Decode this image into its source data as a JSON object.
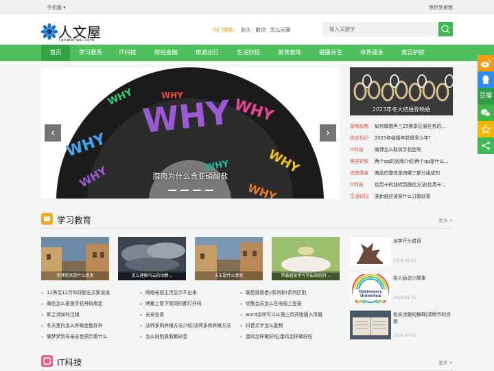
{
  "topbar": {
    "mobile": "手机版 ▾",
    "save": "保存到桌面"
  },
  "logo": {
    "name": "人文屋",
    "domain": "renwenwu.com"
  },
  "hot": {
    "label": "热门搜索:",
    "keywords": [
      "兆头",
      "歌词",
      "怎么回事"
    ]
  },
  "search": {
    "placeholder": "输入关键字"
  },
  "nav": [
    "首页",
    "学习教育",
    "IT科技",
    "财经金融",
    "旅游出行",
    "生活妙招",
    "美食美味",
    "健康养生",
    "体育健身",
    "美容护肤"
  ],
  "banner": {
    "caption": "腊肉为什么含亚硝酸盐",
    "word": "WHY"
  },
  "side": {
    "caption": "2023年冬大结婚算晚婚",
    "news": [
      {
        "cat": "游戏攻略",
        "title": "如何做暗黑三25赛季征服任务的..."
      },
      {
        "cat": "综合知识",
        "title": "2023年结婚年龄是多少年?"
      },
      {
        "cat": "IT科技",
        "title": "微博怎么取消手机型号"
      },
      {
        "cat": "美容护肤",
        "title": "两个qq的品牌介绍|两个qq是什么..."
      },
      {
        "cat": "体育健身",
        "title": "商品的整体是由哪三部分组成的"
      },
      {
        "cat": "IT科技",
        "title": "信用卡的钱转到微信方法|信用卡..."
      },
      {
        "cat": "生活妙招",
        "title": "准新娘应该穿什么订婚好看"
      }
    ]
  },
  "sections": [
    {
      "title": "学习教育",
      "more": "更多 +"
    },
    {
      "title": "IT科技",
      "more": "更多 +"
    }
  ],
  "cards": [
    "老师是否是什么意思",
    "怎么理解乌云的动静...",
    "天王是什么意思",
    "带着超能手写字出来的时..."
  ],
  "list_left": [
    "11再见12月你好励志文案说说",
    "微信怎么更换手机号码绑定",
    "影之诗如何注销",
    "冬天室内怎么养殖金鱼好养",
    "做梦梦到母亲去世预示着什么"
  ],
  "list_mid": [
    "网络电视主页显示不出来",
    "烤箱上管下管同时都打开吗",
    "长安虫茶",
    "法师多肉养殖方法介绍|法师多肉养殖方法",
    "怎么辩别真假紫砂壶"
  ],
  "list_right": [
    "联想拯救者y系列和r系列区别",
    "优酷会员怎么在电视上登录",
    "word怎样可以从第三页开始插入页眉",
    "抖音文字怎么复制",
    "蛋鸡怎样做好吃|蛋鸡怎样做好吃"
  ],
  "right_items": [
    {
      "title": "龙字开头成语",
      "date": "2024-02-01"
    },
    {
      "title": "名人励志小故事",
      "date": "2024-02-01"
    },
    {
      "title": "有关诗歌的解释|清明节的诗歌",
      "date": "2024-02-01"
    }
  ],
  "thumb_text": "Optimizers Unlimited",
  "colors": {
    "green": "#4ec15e",
    "accent": "#3cba54",
    "red": "#e74c3c",
    "orange": "#f39c12"
  },
  "share_icons": [
    "weibo-icon",
    "qq-icon",
    "douban-icon",
    "wechat-icon",
    "star-icon",
    "share-icon"
  ],
  "share_labels": {
    "douban": "豆瓣"
  }
}
